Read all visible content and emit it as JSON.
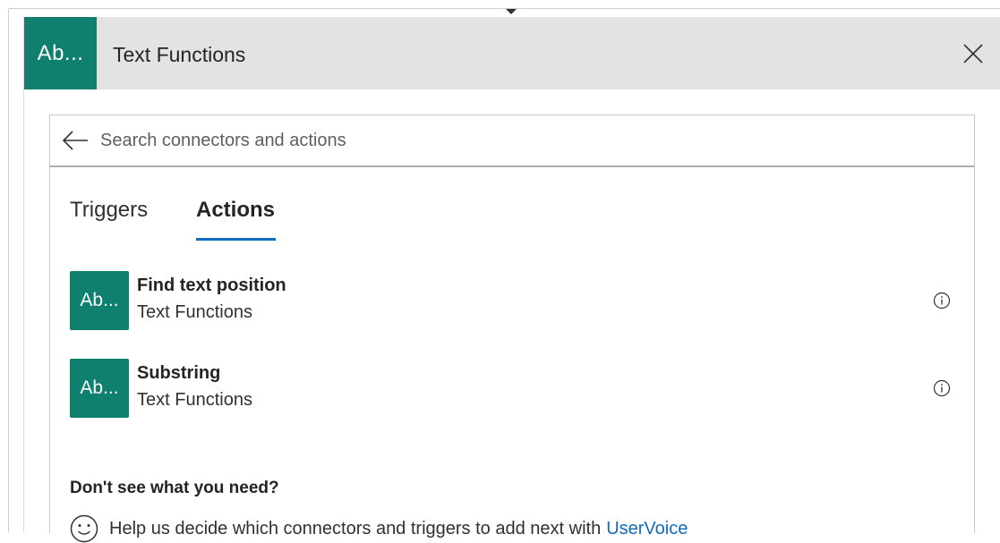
{
  "header": {
    "badge_text": "Ab...",
    "title": "Text Functions",
    "close_icon": "close-icon",
    "badge_color": "#0f7f6e"
  },
  "search": {
    "back_icon": "arrow-left-icon",
    "placeholder": "Search connectors and actions",
    "value": ""
  },
  "tabs": [
    {
      "label": "Triggers",
      "selected": false
    },
    {
      "label": "Actions",
      "selected": true
    }
  ],
  "actions": [
    {
      "icon_text": "Ab...",
      "title": "Find text position",
      "subtitle": "Text Functions",
      "info_icon": "info-icon"
    },
    {
      "icon_text": "Ab...",
      "title": "Substring",
      "subtitle": "Text Functions",
      "info_icon": "info-icon"
    }
  ],
  "feedback": {
    "heading": "Don't see what you need?",
    "icon": "smile-icon",
    "text": "Help us decide which connectors and triggers to add next with",
    "link_text": "UserVoice",
    "link_color": "#0f6cbd"
  }
}
